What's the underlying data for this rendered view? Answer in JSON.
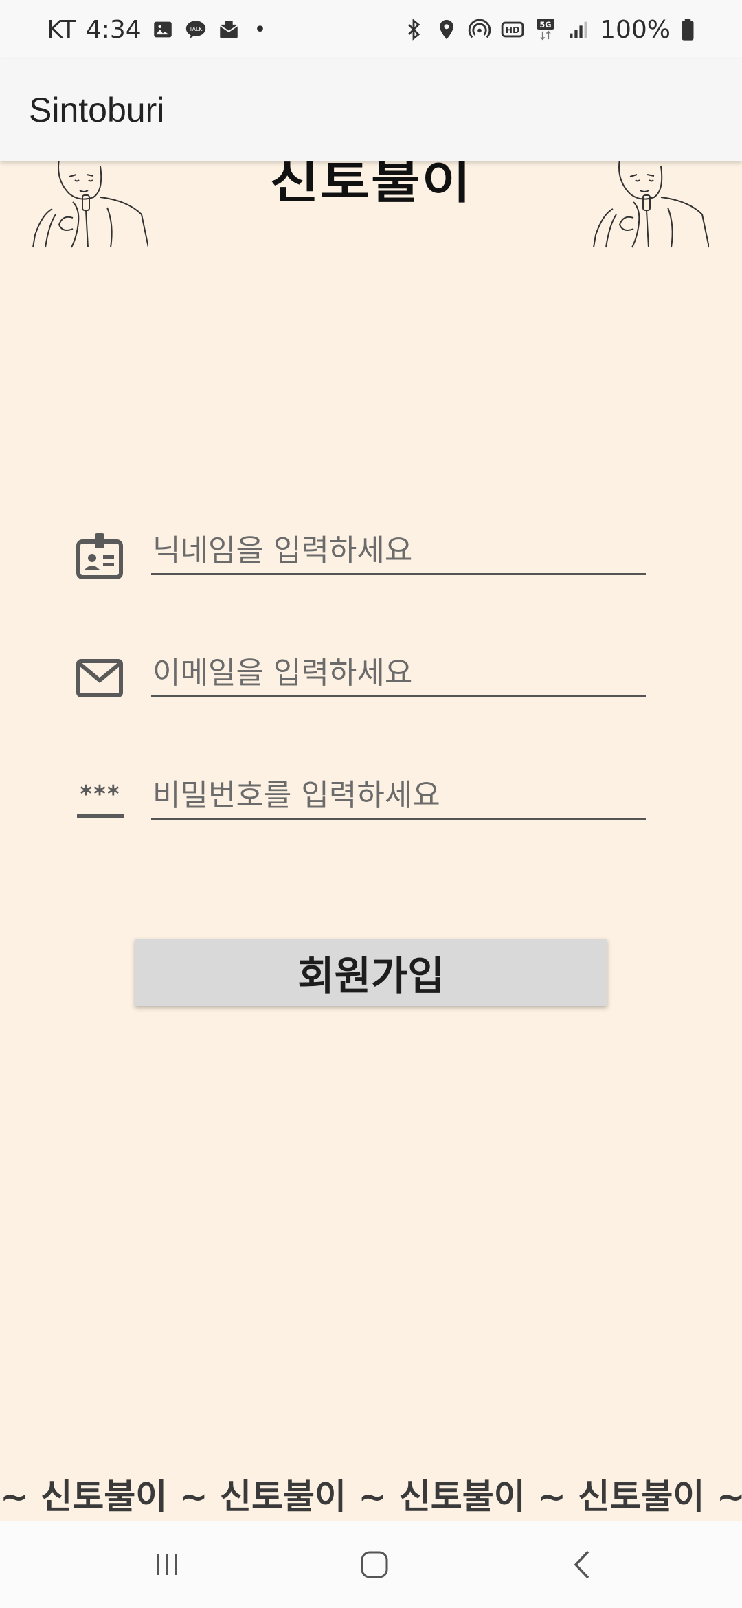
{
  "status_bar": {
    "carrier": "KT",
    "time": "4:34",
    "dot": "•",
    "battery": "100%",
    "icons_left": [
      "image-icon",
      "talk-icon",
      "mail-icon"
    ],
    "icons_right": [
      "bluetooth-icon",
      "location-icon",
      "hotspot-icon",
      "hd-icon",
      "5g-icon",
      "signal-icon",
      "battery-icon"
    ],
    "hd_label": "HD",
    "fiveg_label": "5G",
    "talk_label": "TALK"
  },
  "app_bar": {
    "title": "Sintoburi"
  },
  "header": {
    "logo_text": "신토불이",
    "left_art": "singer-illustration",
    "right_art": "singer-illustration"
  },
  "form": {
    "nickname": {
      "icon": "id-badge-icon",
      "placeholder": "닉네임을 입력하세요",
      "value": ""
    },
    "email": {
      "icon": "mail-icon",
      "placeholder": "이메일을 입력하세요",
      "value": ""
    },
    "password": {
      "icon": "password-icon",
      "placeholder": "비밀번호를 입력하세요",
      "value": "",
      "icon_text": "***"
    }
  },
  "signup_button": {
    "label": "회원가입"
  },
  "footer_marquee": {
    "text": "~ 신토불이 ~ 신토불이 ~ 신토불이 ~ 신토불이 ~"
  },
  "nav_bar": {
    "recent": "recent-apps-icon",
    "home": "home-icon",
    "back": "back-icon"
  },
  "colors": {
    "background": "#fcf1e3",
    "app_bar": "#f6f6f6",
    "button": "#d9d9d9",
    "underline": "#555555"
  }
}
